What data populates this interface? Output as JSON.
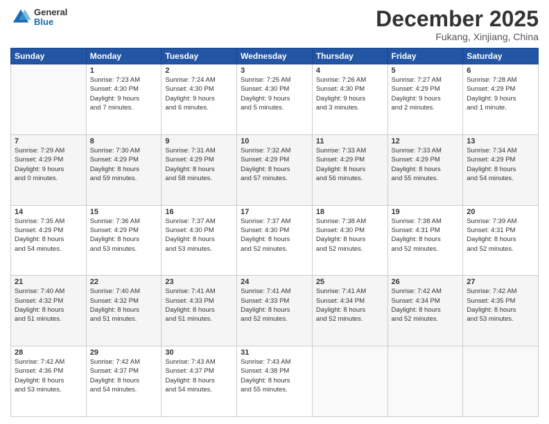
{
  "logo": {
    "general": "General",
    "blue": "Blue"
  },
  "header": {
    "month": "December 2025",
    "location": "Fukang, Xinjiang, China"
  },
  "weekdays": [
    "Sunday",
    "Monday",
    "Tuesday",
    "Wednesday",
    "Thursday",
    "Friday",
    "Saturday"
  ],
  "weeks": [
    [
      {
        "day": "",
        "info": ""
      },
      {
        "day": "1",
        "info": "Sunrise: 7:23 AM\nSunset: 4:30 PM\nDaylight: 9 hours\nand 7 minutes."
      },
      {
        "day": "2",
        "info": "Sunrise: 7:24 AM\nSunset: 4:30 PM\nDaylight: 9 hours\nand 6 minutes."
      },
      {
        "day": "3",
        "info": "Sunrise: 7:25 AM\nSunset: 4:30 PM\nDaylight: 9 hours\nand 5 minutes."
      },
      {
        "day": "4",
        "info": "Sunrise: 7:26 AM\nSunset: 4:30 PM\nDaylight: 9 hours\nand 3 minutes."
      },
      {
        "day": "5",
        "info": "Sunrise: 7:27 AM\nSunset: 4:29 PM\nDaylight: 9 hours\nand 2 minutes."
      },
      {
        "day": "6",
        "info": "Sunrise: 7:28 AM\nSunset: 4:29 PM\nDaylight: 9 hours\nand 1 minute."
      }
    ],
    [
      {
        "day": "7",
        "info": "Sunrise: 7:29 AM\nSunset: 4:29 PM\nDaylight: 9 hours\nand 0 minutes."
      },
      {
        "day": "8",
        "info": "Sunrise: 7:30 AM\nSunset: 4:29 PM\nDaylight: 8 hours\nand 59 minutes."
      },
      {
        "day": "9",
        "info": "Sunrise: 7:31 AM\nSunset: 4:29 PM\nDaylight: 8 hours\nand 58 minutes."
      },
      {
        "day": "10",
        "info": "Sunrise: 7:32 AM\nSunset: 4:29 PM\nDaylight: 8 hours\nand 57 minutes."
      },
      {
        "day": "11",
        "info": "Sunrise: 7:33 AM\nSunset: 4:29 PM\nDaylight: 8 hours\nand 56 minutes."
      },
      {
        "day": "12",
        "info": "Sunrise: 7:33 AM\nSunset: 4:29 PM\nDaylight: 8 hours\nand 55 minutes."
      },
      {
        "day": "13",
        "info": "Sunrise: 7:34 AM\nSunset: 4:29 PM\nDaylight: 8 hours\nand 54 minutes."
      }
    ],
    [
      {
        "day": "14",
        "info": "Sunrise: 7:35 AM\nSunset: 4:29 PM\nDaylight: 8 hours\nand 54 minutes."
      },
      {
        "day": "15",
        "info": "Sunrise: 7:36 AM\nSunset: 4:29 PM\nDaylight: 8 hours\nand 53 minutes."
      },
      {
        "day": "16",
        "info": "Sunrise: 7:37 AM\nSunset: 4:30 PM\nDaylight: 8 hours\nand 53 minutes."
      },
      {
        "day": "17",
        "info": "Sunrise: 7:37 AM\nSunset: 4:30 PM\nDaylight: 8 hours\nand 52 minutes."
      },
      {
        "day": "18",
        "info": "Sunrise: 7:38 AM\nSunset: 4:30 PM\nDaylight: 8 hours\nand 52 minutes."
      },
      {
        "day": "19",
        "info": "Sunrise: 7:38 AM\nSunset: 4:31 PM\nDaylight: 8 hours\nand 52 minutes."
      },
      {
        "day": "20",
        "info": "Sunrise: 7:39 AM\nSunset: 4:31 PM\nDaylight: 8 hours\nand 52 minutes."
      }
    ],
    [
      {
        "day": "21",
        "info": "Sunrise: 7:40 AM\nSunset: 4:32 PM\nDaylight: 8 hours\nand 51 minutes."
      },
      {
        "day": "22",
        "info": "Sunrise: 7:40 AM\nSunset: 4:32 PM\nDaylight: 8 hours\nand 51 minutes."
      },
      {
        "day": "23",
        "info": "Sunrise: 7:41 AM\nSunset: 4:33 PM\nDaylight: 8 hours\nand 51 minutes."
      },
      {
        "day": "24",
        "info": "Sunrise: 7:41 AM\nSunset: 4:33 PM\nDaylight: 8 hours\nand 52 minutes."
      },
      {
        "day": "25",
        "info": "Sunrise: 7:41 AM\nSunset: 4:34 PM\nDaylight: 8 hours\nand 52 minutes."
      },
      {
        "day": "26",
        "info": "Sunrise: 7:42 AM\nSunset: 4:34 PM\nDaylight: 8 hours\nand 52 minutes."
      },
      {
        "day": "27",
        "info": "Sunrise: 7:42 AM\nSunset: 4:35 PM\nDaylight: 8 hours\nand 53 minutes."
      }
    ],
    [
      {
        "day": "28",
        "info": "Sunrise: 7:42 AM\nSunset: 4:36 PM\nDaylight: 8 hours\nand 53 minutes."
      },
      {
        "day": "29",
        "info": "Sunrise: 7:42 AM\nSunset: 4:37 PM\nDaylight: 8 hours\nand 54 minutes."
      },
      {
        "day": "30",
        "info": "Sunrise: 7:43 AM\nSunset: 4:37 PM\nDaylight: 8 hours\nand 54 minutes."
      },
      {
        "day": "31",
        "info": "Sunrise: 7:43 AM\nSunset: 4:38 PM\nDaylight: 8 hours\nand 55 minutes."
      },
      {
        "day": "",
        "info": ""
      },
      {
        "day": "",
        "info": ""
      },
      {
        "day": "",
        "info": ""
      }
    ]
  ]
}
